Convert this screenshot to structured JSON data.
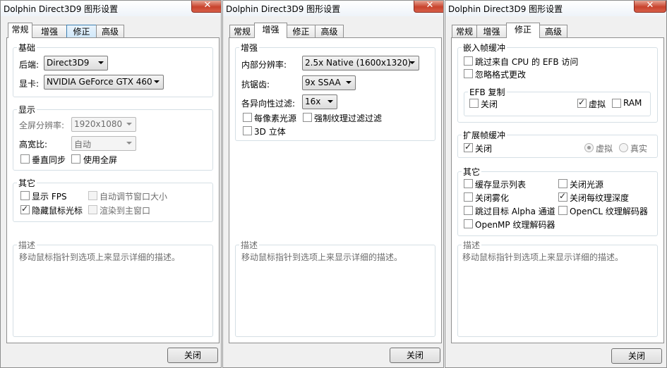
{
  "app_title": "Dolphin Direct3D9 图形设置",
  "close_glyph": "✕",
  "check_glyph": "✓",
  "tabs": [
    "常规",
    "增强",
    "修正",
    "高级"
  ],
  "close_button": "关闭",
  "description": {
    "title": "描述",
    "text": "移动鼠标指针到选项上来显示详细的描述。"
  },
  "general": {
    "basic": {
      "title": "基础",
      "backend_label": "后端:",
      "backend": "Direct3D9",
      "adapter_label": "显卡:",
      "adapter": "NVIDIA GeForce GTX 460"
    },
    "display": {
      "title": "显示",
      "fullscreen_res_label": "全屏分辨率:",
      "fullscreen_res": "1920x1080",
      "aspect_label": "高宽比:",
      "aspect": "自动",
      "vsync": "垂直同步",
      "use_fullscreen": "使用全屏"
    },
    "other": {
      "title": "其它",
      "show_fps": "显示 FPS",
      "auto_adjust": "自动调节窗口大小",
      "hide_cursor": "隐藏鼠标光标",
      "render_main": "渲染到主窗口"
    }
  },
  "enhancements": {
    "title": "增强",
    "internal_res_label": "内部分辨率:",
    "internal_res": "2.5x Native (1600x1320)",
    "aa_label": "抗锯齿:",
    "aa": "9x SSAA",
    "af_label": "各异向性过滤:",
    "af": "16x",
    "per_pixel": "每像素光源",
    "force_filter": "强制纹理过滤过滤",
    "stereo": "3D 立体"
  },
  "hacks": {
    "embedded": {
      "title": "嵌入帧缓冲",
      "skip_efb": "跳过来自 CPU 的 EFB 访问",
      "ignore_format": "忽略格式更改",
      "efb_copy": {
        "title": "EFB 复制",
        "off": "关闭",
        "virtual": "虚拟",
        "ram": "RAM"
      }
    },
    "external": {
      "title": "扩展帧缓冲",
      "off": "关闭",
      "virtual": "虚拟",
      "real": "真实"
    },
    "other": {
      "title": "其它",
      "cache_dl": "缓存显示列表",
      "disable_lighting": "关闭光源",
      "disable_fog": "关闭雾化",
      "disable_depth": "关闭每纹理深度",
      "skip_alpha": "跳过目标 Alpha 通道",
      "opencl": "OpenCL 纹理解码器",
      "openmp": "OpenMP 纹理解码器"
    }
  }
}
